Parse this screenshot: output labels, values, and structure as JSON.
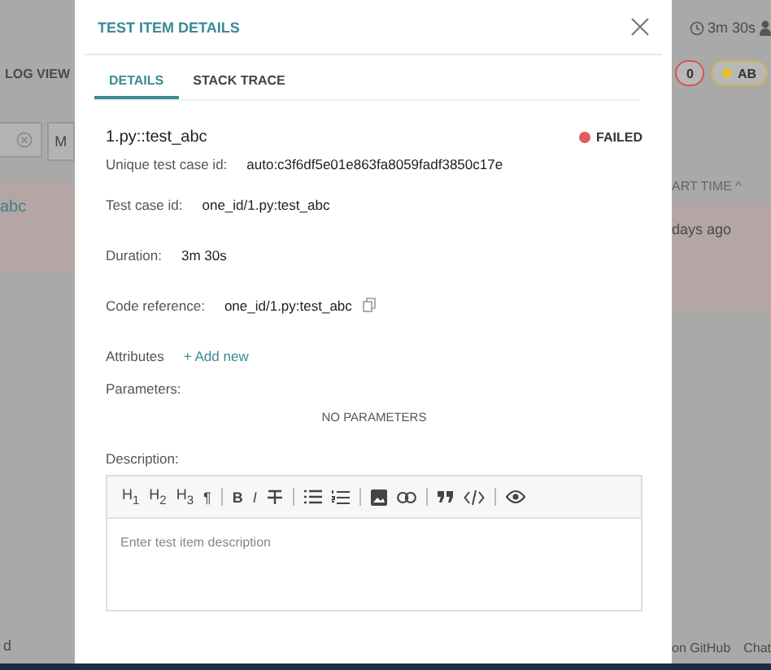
{
  "background": {
    "left": {
      "view_label": "LOG VIEW",
      "filter_button": "M",
      "row_name": "abc",
      "footer_text": "d"
    },
    "right": {
      "duration": "3m 30s",
      "badges": [
        {
          "label": "0",
          "color": "#d9534f"
        },
        {
          "label": "AB",
          "color": "#e6c229"
        }
      ],
      "column_header": "ART TIME",
      "sort_mark": "^",
      "row_time": "days ago",
      "footer_links": [
        "on GitHub",
        "Chat"
      ]
    }
  },
  "modal": {
    "title": "TEST ITEM DETAILS",
    "tabs": [
      {
        "label": "DETAILS",
        "selected": true
      },
      {
        "label": "STACK TRACE",
        "selected": false
      }
    ],
    "item_name": "1.py::test_abc",
    "status": {
      "label": "FAILED",
      "color": "#e35b5b"
    },
    "fields": [
      {
        "kind": "text",
        "label": "Unique test case id:",
        "value": "auto:c3f6df5e01e863fa8059fadf3850c17e"
      },
      {
        "kind": "text",
        "label": "Test case id:",
        "value": "one_id/1.py:test_abc"
      },
      {
        "kind": "text",
        "label": "Duration:",
        "value": "3m 30s"
      },
      {
        "kind": "copy",
        "label": "Code reference:",
        "value": "one_id/1.py:test_abc"
      },
      {
        "kind": "link",
        "label": "Attributes",
        "value": "+ Add new"
      }
    ],
    "parameters": {
      "label": "Parameters:",
      "empty_text": "NO PARAMETERS"
    },
    "description": {
      "label": "Description:",
      "placeholder": "Enter test item description",
      "toolbar": [
        [
          {
            "kind": "heading",
            "label": "H$_{1}$"
          },
          {
            "kind": "heading",
            "label": "H$_{2}$"
          },
          {
            "kind": "heading",
            "label": "H$_{3}$"
          },
          {
            "kind": "char",
            "label": "¶"
          }
        ],
        [
          {
            "kind": "bold",
            "label": "B"
          },
          {
            "kind": "italic",
            "label": "I"
          },
          {
            "kind": "strike"
          }
        ],
        [
          {
            "kind": "bullet-list"
          },
          {
            "kind": "numbered-list"
          }
        ],
        [
          {
            "kind": "image"
          },
          {
            "kind": "link"
          }
        ],
        [
          {
            "kind": "quote"
          },
          {
            "kind": "code"
          }
        ],
        [
          {
            "kind": "preview"
          }
        ]
      ]
    }
  }
}
